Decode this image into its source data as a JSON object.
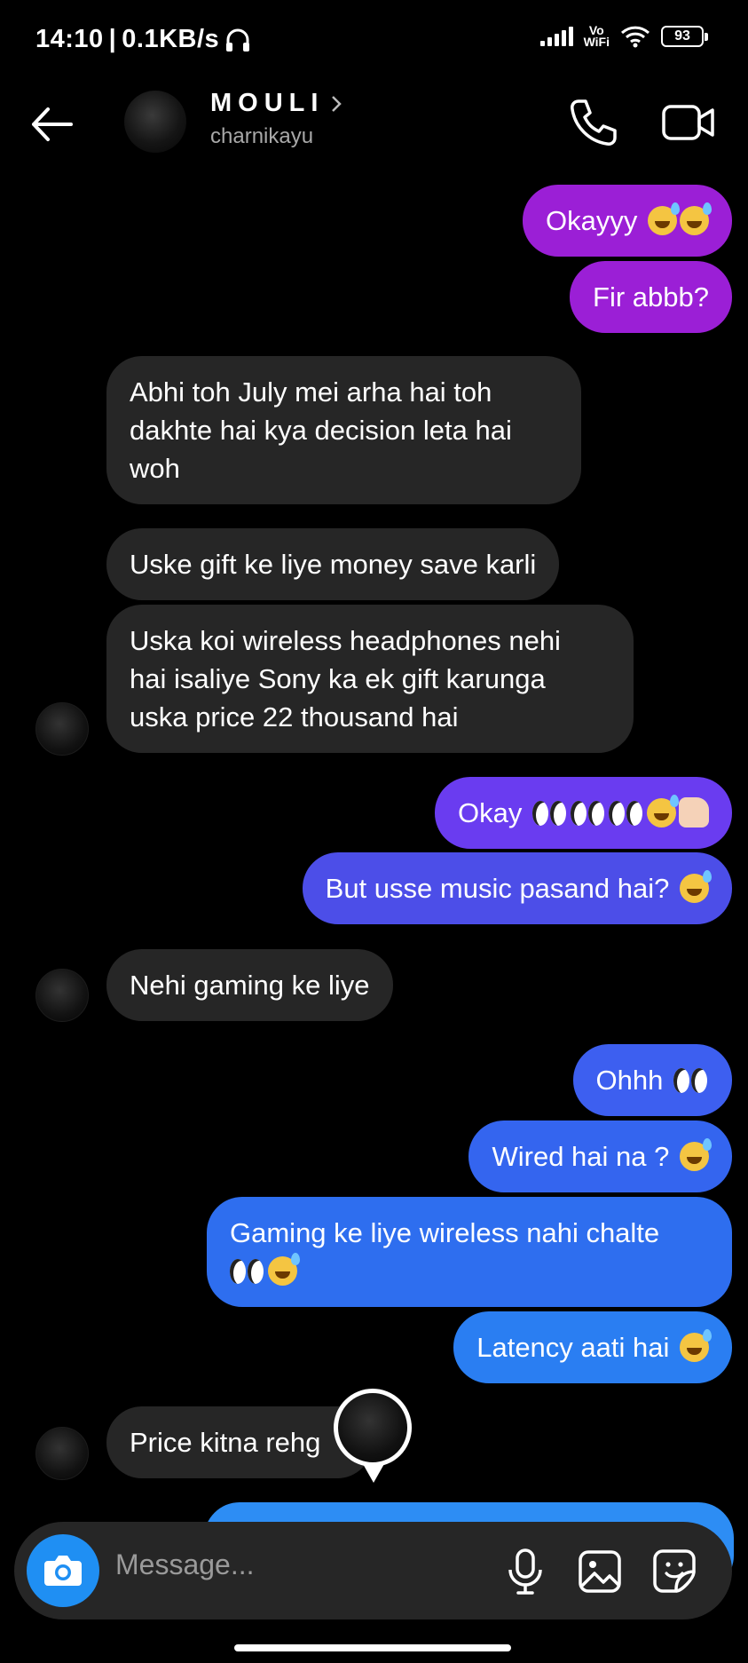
{
  "status_bar": {
    "time": "14:10",
    "speed": "0.1KB/s",
    "network_label_top": "Vo",
    "network_label_bottom": "WiFi",
    "battery": "93"
  },
  "header": {
    "name": "MOULI",
    "username": "charnikayu"
  },
  "colors": {
    "bubble_incoming": "#262626",
    "bubble_purple": "#9b1fd6",
    "bubble_violet": "#6a3cf0",
    "bubble_indigo": "#4c4ee8",
    "bubble_blue": "#2e66ee",
    "bubble_blue_light": "#2d8df4",
    "accent": "#1f8ff3"
  },
  "messages": [
    {
      "id": "m1",
      "direction": "out",
      "text": "Okayyy",
      "emojis": [
        "grinning-sweat",
        "grinning-sweat"
      ]
    },
    {
      "id": "m2",
      "direction": "out",
      "text": "Fir abbb?",
      "emojis": []
    },
    {
      "id": "m3",
      "direction": "in",
      "lines": [
        "Abhi toh July mei arha hai toh",
        "dakhte hai kya decision leta hai",
        "woh"
      ]
    },
    {
      "id": "m4",
      "direction": "in",
      "text": "Uske gift ke liye money save karli"
    },
    {
      "id": "m5",
      "direction": "in",
      "lines": [
        "Uska koi wireless headphones nehi",
        "hai isaliye Sony ka ek gift karunga",
        "uska price 22 thousand hai"
      ]
    },
    {
      "id": "m6",
      "direction": "out",
      "text": "Okay",
      "emojis": [
        "eyes",
        "eyes",
        "eyes",
        "grinning-sweat",
        "thumbs-up"
      ]
    },
    {
      "id": "m7",
      "direction": "out",
      "text": "But usse music pasand hai?",
      "emojis": [
        "grinning-sweat"
      ]
    },
    {
      "id": "m8",
      "direction": "in",
      "text": "Nehi gaming ke liye"
    },
    {
      "id": "m9",
      "direction": "out",
      "text": "Ohhh",
      "emojis": [
        "eyes"
      ]
    },
    {
      "id": "m10",
      "direction": "out",
      "text": "Wired hai na ?",
      "emojis": [
        "grinning-sweat"
      ]
    },
    {
      "id": "m11",
      "direction": "out",
      "lines": [
        "Gaming ke liye wireless nahi chalte"
      ],
      "emojis": [
        "eyes",
        "grinning-sweat"
      ]
    },
    {
      "id": "m12",
      "direction": "out",
      "text": "Latency aati hai",
      "emojis": [
        "grinning-sweat"
      ]
    },
    {
      "id": "m13",
      "direction": "in",
      "text": "Price kitna rehg"
    }
  ],
  "composer": {
    "placeholder": "Message..."
  }
}
